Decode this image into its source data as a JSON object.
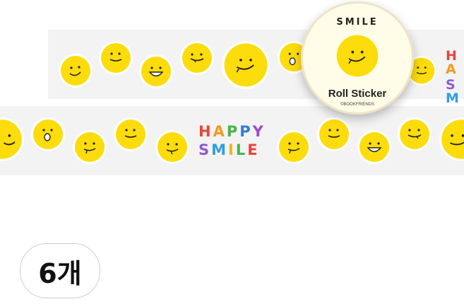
{
  "tape_text": {
    "word1": [
      "H",
      "A",
      "P",
      "P",
      "Y"
    ],
    "word2": [
      "S",
      "M",
      "I",
      "L",
      "E"
    ]
  },
  "roll_sticker": {
    "title": "SMILE",
    "label": "Roll Sticker",
    "brand": "©BOOKFRIENDS"
  },
  "count_badge": {
    "label": "6개"
  },
  "colors": {
    "smiley_fill": "#fddc0b",
    "tape_background": "#f3f3f3",
    "happy_letters": [
      "#e8443a",
      "#f39a1e",
      "#49b24a",
      "#2f7fd6",
      "#9c4dcc"
    ],
    "smile_letters": [
      "#8e5bd0",
      "#2f9fe0",
      "#f3b41c",
      "#45b649",
      "#e8443a"
    ]
  }
}
